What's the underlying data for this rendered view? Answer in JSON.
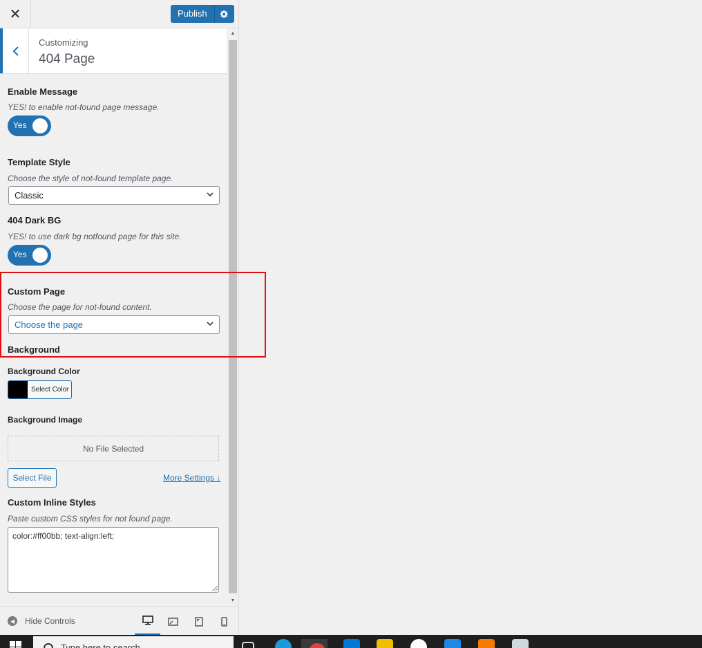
{
  "header": {
    "close_glyph": "✕",
    "publish_label": "Publish"
  },
  "section": {
    "breadcrumb": "Customizing",
    "title": "404 Page"
  },
  "controls": {
    "enable_message": {
      "label": "Enable Message",
      "description": "YES! to enable not-found page message.",
      "toggle_text": "Yes"
    },
    "template_style": {
      "label": "Template Style",
      "description": "Choose the style of not-found template page.",
      "selected": "Classic"
    },
    "dark_bg": {
      "label": "404 Dark BG",
      "description": "YES! to use dark bg notfound page for this site.",
      "toggle_text": "Yes"
    },
    "custom_page": {
      "label": "Custom Page",
      "description": "Choose the page for not-found content.",
      "selected": "Choose the page"
    },
    "background_heading": "Background",
    "background_color": {
      "label": "Background Color",
      "button_label": "Select Color",
      "swatch_color": "#000000"
    },
    "background_image": {
      "label": "Background Image",
      "placeholder": "No File Selected",
      "select_button": "Select File",
      "more_link": "More Settings ↓"
    },
    "inline_styles": {
      "label": "Custom Inline Styles",
      "description": "Paste custom CSS styles for not found page.",
      "value": "color:#ff00bb; text-align:left;"
    }
  },
  "footer": {
    "hide_controls": "Hide Controls"
  },
  "taskbar": {
    "search_placeholder": "Type here to search"
  },
  "colors": {
    "accent": "#2271b1",
    "highlight_border": "#e01010"
  }
}
